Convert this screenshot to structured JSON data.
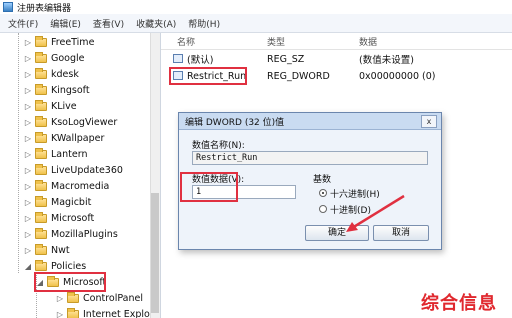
{
  "window": {
    "title": "注册表编辑器"
  },
  "menu": [
    "文件(F)",
    "编辑(E)",
    "查看(V)",
    "收藏夹(A)",
    "帮助(H)"
  ],
  "tree": {
    "items": [
      {
        "label": "FreeTime"
      },
      {
        "label": "Google"
      },
      {
        "label": "kdesk"
      },
      {
        "label": "Kingsoft"
      },
      {
        "label": "KLive"
      },
      {
        "label": "KsoLogViewer"
      },
      {
        "label": "KWallpaper"
      },
      {
        "label": "Lantern"
      },
      {
        "label": "LiveUpdate360"
      },
      {
        "label": "Macromedia"
      },
      {
        "label": "Magicbit"
      },
      {
        "label": "Microsoft"
      },
      {
        "label": "MozillaPlugins"
      },
      {
        "label": "Nwt"
      },
      {
        "label": "Policies"
      },
      {
        "label": "Microsoft",
        "selected": true
      },
      {
        "label": "ControlPanel"
      },
      {
        "label": "Internet Explore"
      }
    ]
  },
  "list": {
    "columns": [
      "名称",
      "类型",
      "数据"
    ],
    "rows": [
      {
        "name": "(默认)",
        "type": "REG_SZ",
        "data": "(数值未设置)"
      },
      {
        "name": "Restrict_Run",
        "type": "REG_DWORD",
        "data": "0x00000000 (0)"
      }
    ]
  },
  "dialog": {
    "title": "编辑 DWORD (32 位)值",
    "close": "x",
    "name_label": "数值名称(N):",
    "name_value": "Restrict_Run",
    "data_label": "数值数据(V):",
    "data_value": "1",
    "base_label": "基数",
    "radio_hex": "十六进制(H)",
    "radio_dec": "十进制(D)",
    "ok": "确定",
    "cancel": "取消"
  },
  "watermark": "综合信息",
  "colors": {
    "highlight": "#e03040",
    "watermark": "#e0282e"
  }
}
